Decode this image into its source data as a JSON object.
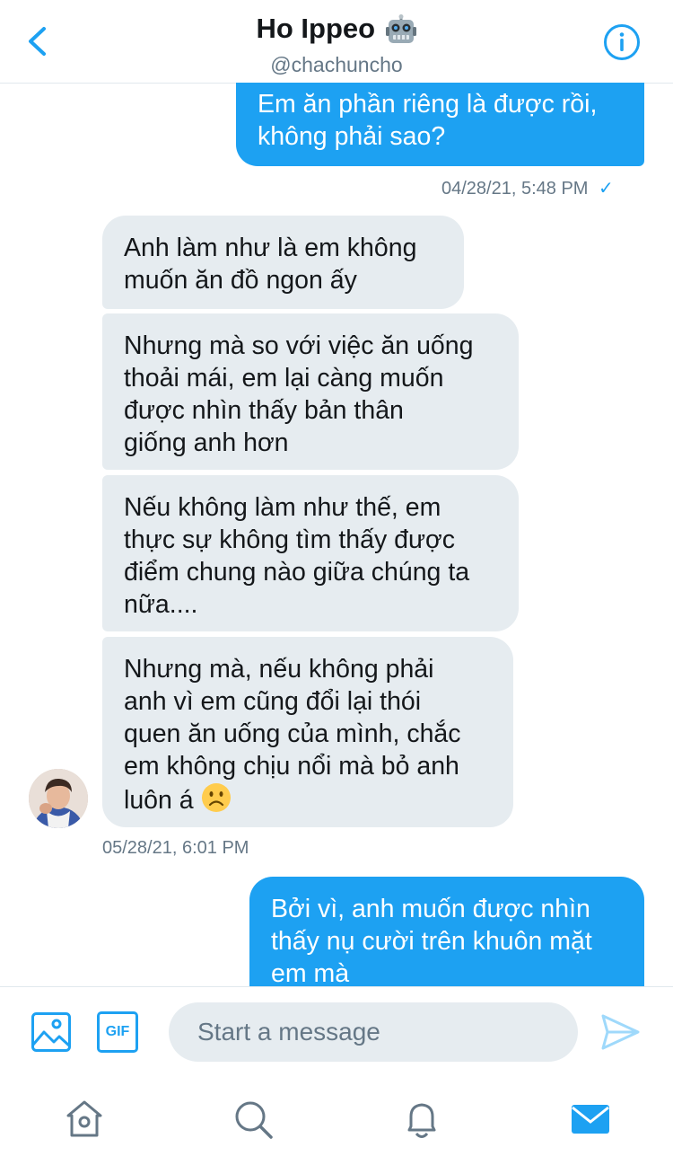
{
  "header": {
    "name": "Ho Ippeo",
    "handle": "@chachuncho",
    "title_icon": "robot-emoji",
    "back_icon": "chevron-left-icon",
    "info_icon": "info-icon"
  },
  "messages": [
    {
      "side": "out",
      "text": "Em ăn phần riêng là được rồi,\nkhông phải sao?"
    },
    {
      "side": "in",
      "text": "Anh làm như là em không\nmuốn ăn đồ ngon ấy"
    },
    {
      "side": "in",
      "text": "Nhưng mà so với việc ăn uống\nthoải mái, em lại càng muốn\nđược nhìn thấy bản thân\ngiống anh hơn"
    },
    {
      "side": "in",
      "text": "Nếu không làm như thế, em\nthực sự không tìm thấy được\nđiểm chung nào giữa chúng ta\nnữa...."
    },
    {
      "side": "in",
      "text": "Nhưng mà, nếu không phải\nanh vì em cũng đổi lại thói\nquen ăn uống của mình, chắc\nem không chịu nổi mà bỏ anh\nluôn á",
      "emoji": "frowning-face-emoji"
    },
    {
      "side": "out",
      "text": "Bởi vì, anh muốn được nhìn\nthấy nụ cười trên khuôn mặt\nem mà"
    }
  ],
  "timestamps": {
    "first": "04/28/21, 5:48 PM",
    "first_status": "✓",
    "second": "05/28/21, 6:01 PM"
  },
  "composer": {
    "placeholder": "Start a message",
    "gif_label": "GIF",
    "image_icon": "image-icon",
    "send_icon": "send-icon"
  },
  "tabs": [
    {
      "name": "home",
      "icon": "home-icon",
      "active": false
    },
    {
      "name": "search",
      "icon": "search-icon",
      "active": false
    },
    {
      "name": "notifications",
      "icon": "bell-icon",
      "active": false
    },
    {
      "name": "messages",
      "icon": "mail-icon",
      "active": true
    }
  ],
  "colors": {
    "accent": "#1da1f2",
    "incoming_bubble": "#e6ecf0",
    "secondary_text": "#657786"
  }
}
